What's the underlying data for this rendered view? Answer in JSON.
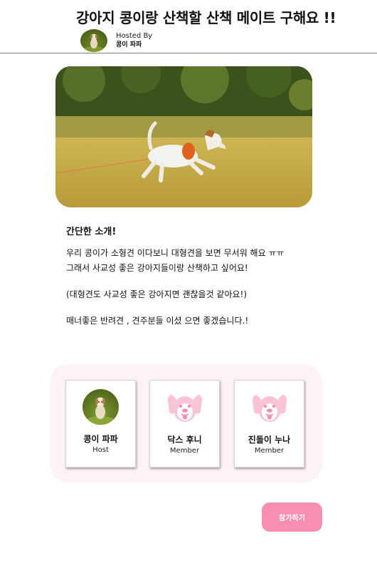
{
  "page": {
    "title": "강아지 콩이랑 산책할 산책 메이트 구해요 !!"
  },
  "host": {
    "hosted_by_label": "Hosted By",
    "name": "콩이 파파"
  },
  "intro": {
    "heading": "간단한 소개!",
    "lines": [
      "우리 콩이가 소형견 이다보니 대형견을 보면 무서워 해요 ㅠㅠ",
      "그래서 사교성 좋은 강아지들이랑 산책하고 싶어요!",
      "(대형견도 사교성 좋은 강아지면 괜찮을것 같아요!)",
      "매너좋은 반려견 , 견주분들 이셨 으면 좋겠습니다.!"
    ]
  },
  "members": [
    {
      "name": "콩이 파파",
      "role": "Host",
      "avatar": "dog-photo"
    },
    {
      "name": "닥스 후니",
      "role": "Member",
      "avatar": "dog-face-icon"
    },
    {
      "name": "진돌이 누나",
      "role": "Member",
      "avatar": "dog-face-icon"
    }
  ],
  "actions": {
    "join_label": "참가하기"
  },
  "colors": {
    "accent_pink": "#f78fb3",
    "panel_background": "#fdf3f7",
    "dog_icon_pink": "#f9c4d6"
  }
}
